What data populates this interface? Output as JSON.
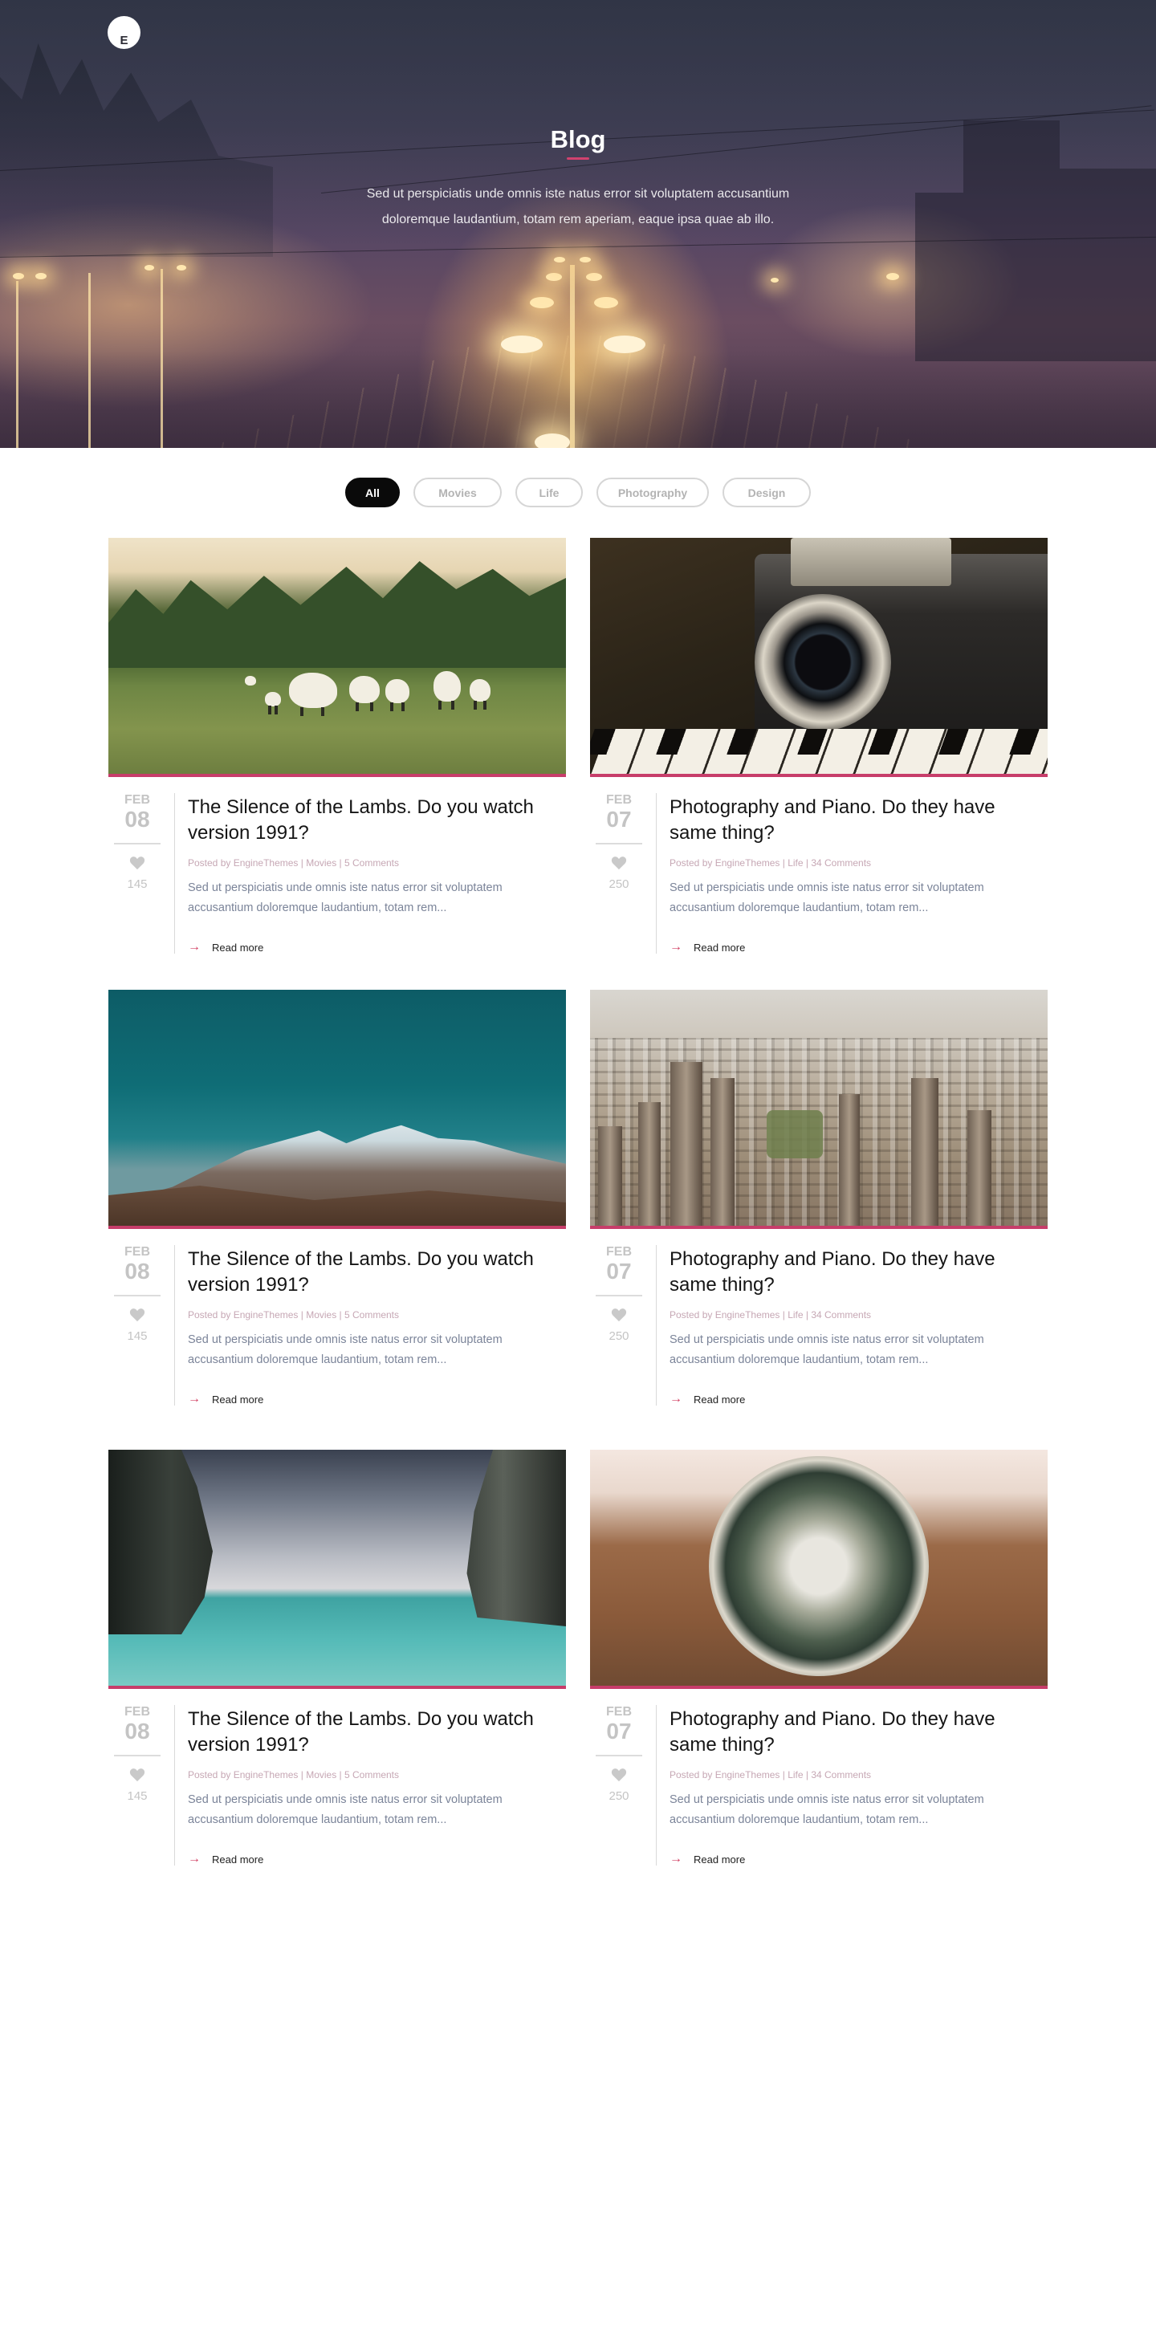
{
  "logo": {
    "letter": "E"
  },
  "hero": {
    "title": "Blog",
    "subtitle": "Sed ut perspiciatis unde omnis iste natus error sit voluptatem accusantium doloremque laudantium, totam rem aperiam, eaque ipsa quae ab illo."
  },
  "filters": [
    {
      "label": "All",
      "active": true
    },
    {
      "label": "Movies",
      "active": false
    },
    {
      "label": "Life",
      "active": false
    },
    {
      "label": "Photography",
      "active": false
    },
    {
      "label": "Design",
      "active": false
    }
  ],
  "posts": [
    {
      "month": "FEB",
      "day": "08",
      "likes": "145",
      "title": "The Silence of the Lambs. Do you watch version 1991?",
      "meta": "Posted by EngineThemes | Movies | 5 Comments",
      "excerpt": "Sed ut perspiciatis unde omnis iste natus error sit voluptatem accusantium doloremque laudantium, totam rem...",
      "read_more": "Read more"
    },
    {
      "month": "FEB",
      "day": "07",
      "likes": "250",
      "title": "Photography and Piano. Do they have same thing?",
      "meta": "Posted by EngineThemes | Life | 34 Comments",
      "excerpt": "Sed ut perspiciatis unde omnis iste natus error sit voluptatem accusantium doloremque laudantium, totam rem...",
      "read_more": "Read more"
    },
    {
      "month": "FEB",
      "day": "08",
      "likes": "145",
      "title": "The Silence of the Lambs. Do you watch version 1991?",
      "meta": "Posted by EngineThemes | Movies | 5 Comments",
      "excerpt": "Sed ut perspiciatis unde omnis iste natus error sit voluptatem accusantium doloremque laudantium, totam rem...",
      "read_more": "Read more"
    },
    {
      "month": "FEB",
      "day": "07",
      "likes": "250",
      "title": "Photography and Piano. Do they have same thing?",
      "meta": "Posted by EngineThemes | Life | 34 Comments",
      "excerpt": "Sed ut perspiciatis unde omnis iste natus error sit voluptatem accusantium doloremque laudantium, totam rem...",
      "read_more": "Read more"
    },
    {
      "month": "FEB",
      "day": "08",
      "likes": "145",
      "title": "The Silence of the Lambs. Do you watch version 1991?",
      "meta": "Posted by EngineThemes | Movies | 5 Comments",
      "excerpt": "Sed ut perspiciatis unde omnis iste natus error sit voluptatem accusantium doloremque laudantium, totam rem...",
      "read_more": "Read more"
    },
    {
      "month": "FEB",
      "day": "07",
      "likes": "250",
      "title": "Photography and Piano. Do they have same thing?",
      "meta": "Posted by EngineThemes | Life | 34 Comments",
      "excerpt": "Sed ut perspiciatis unde omnis iste natus error sit voluptatem accusantium doloremque laudantium, totam rem...",
      "read_more": "Read more"
    }
  ],
  "colors": {
    "accent": "#c73d6a",
    "active_filter": "#0a0a0a",
    "meta_text": "#c6a7b4",
    "excerpt_text": "#7b8499"
  }
}
